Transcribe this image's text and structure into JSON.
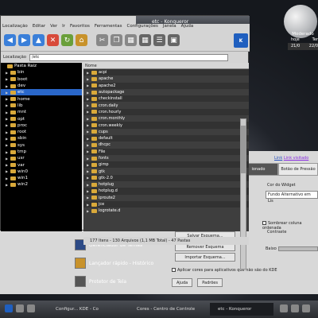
{
  "weather": {
    "label": "Moderado",
    "tabs": [
      "hoje",
      "Ter"
    ],
    "temps": [
      "21/0",
      "22/0"
    ]
  },
  "window": {
    "title": "etc - Konqueror"
  },
  "menu": [
    "Localização",
    "Editar",
    "Ver",
    "Ir",
    "Favoritos",
    "Ferramentas",
    "Configurações",
    "Janela",
    "Ajuda"
  ],
  "location": {
    "label": "Localização",
    "value": "/etc"
  },
  "tree": {
    "root": "Pasta Raiz",
    "items": [
      "bin",
      "boot",
      "dev",
      "etc",
      "home",
      "lib",
      "mnt",
      "opt",
      "proc",
      "root",
      "sbin",
      "sys",
      "tmp",
      "usr",
      "var",
      "win0",
      "win1",
      "win2"
    ],
    "selected": "etc"
  },
  "list": {
    "header": "Nome",
    "items": [
      "acpi",
      "apache",
      "apache2",
      "autopackage",
      "checkinstall",
      "cron.daily",
      "cron.hourly",
      "cron.monthly",
      "cron.weekly",
      "cups",
      "default",
      "dhcpc",
      "File",
      "fonts",
      "gimp",
      "gtk",
      "gtk-2.0",
      "hotplug",
      "hotplug.d",
      "iproute2",
      "jce",
      "logrotate.d"
    ]
  },
  "status": "177 Itens - 130 Arquivos (1,1 MB Total) - 47 Pastas",
  "control": {
    "links": [
      "Link",
      "Link visitado"
    ],
    "tabs": [
      "ionado",
      "Botão de Pressão"
    ],
    "buttons": [
      "Salvar Esquema...",
      "Remover Esquema",
      "Importar Esquema..."
    ],
    "widget_color_label": "Cor do Widget",
    "alt_bg": "Fundo Alternativo em Lis",
    "shade_label": "Sombrear coluna ordenada",
    "contrast": "Contraste",
    "low": "Baixo",
    "apply_label": "Aplicar cores para aplicativos que não são do KDE",
    "help": "Ajuda",
    "defaults": "Padrões",
    "modules": [
      "Gerenciador de Temas",
      "Lançador rápido - Histórico",
      "Protetor de Tela"
    ]
  },
  "taskbar": {
    "tasks": [
      "Configur... KDE - Co",
      "Cores - Centro de Controle",
      "etc - Konqueror"
    ],
    "active": "etc - Konqueror"
  },
  "colors": {
    "selection": "#2a67c9",
    "folder": "#d9a93a",
    "kde_blue": "#1f5fbf"
  }
}
